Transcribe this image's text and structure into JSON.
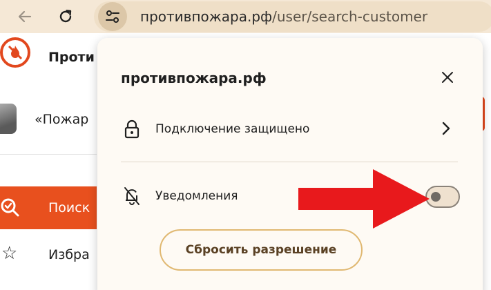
{
  "browser": {
    "url_domain": "противпожара.рф",
    "url_path": "/user/search-customer",
    "icons": {
      "back": "arrow-left-icon",
      "reload": "reload-icon",
      "site_info": "tune-icon"
    }
  },
  "background_page": {
    "brand_name": "Проти",
    "quote_text": "«Пожар",
    "search_item": "Поиск",
    "favorites_item": "Избра",
    "accent_color": "#e8501e"
  },
  "popup": {
    "title": "противпожара.рф",
    "connection_label": "Подключение защищено",
    "notifications_label": "Уведомления",
    "notifications_enabled": false,
    "reset_button_label": "Сбросить разрешение",
    "icons": {
      "close": "close-icon",
      "lock": "lock-icon",
      "bell": "bell-off-icon",
      "chevron": "chevron-right-icon"
    }
  },
  "annotation": {
    "type": "arrow",
    "color": "#e8191c",
    "points_to": "notifications-toggle"
  }
}
